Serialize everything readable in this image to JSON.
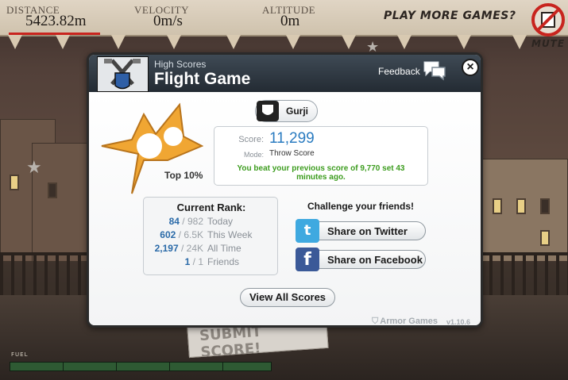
{
  "hud": {
    "distance_label": "DISTANCE",
    "distance_value": "5423.82m",
    "velocity_label": "VELOCITY",
    "velocity_value": "0m/s",
    "altitude_label": "ALTITUDE",
    "altitude_value": "0m",
    "more_games": "PLAY MORE GAMES?",
    "mute_label": "MUTE",
    "fuel_label": "FUEL",
    "fuel_level": 1.0
  },
  "submit_paper_text": "SUBMIT SCORE!",
  "dialog": {
    "subtitle": "High Scores",
    "title": "Flight Game",
    "feedback_label": "Feedback",
    "close_symbol": "×",
    "badge_label": "Top 10%",
    "user_name": "Gurji",
    "score_label": "Score:",
    "score_value": "11,299",
    "mode_label": "Mode:",
    "mode_value": "Throw Score",
    "beat_message": "You beat your previous score of 9,770 set 43 minutes ago.",
    "rank": {
      "title": "Current Rank:",
      "rows": [
        {
          "rank": "84",
          "total": "982",
          "period": "Today"
        },
        {
          "rank": "602",
          "total": "6.5K",
          "period": "This Week"
        },
        {
          "rank": "2,197",
          "total": "24K",
          "period": "All Time"
        },
        {
          "rank": "1",
          "total": "1",
          "period": "Friends"
        }
      ]
    },
    "challenge_title": "Challenge your friends!",
    "twitter_label": "Share on Twitter",
    "facebook_label": "Share on Facebook",
    "view_all_label": "View All Scores",
    "brand": "Armor Games",
    "version": "v1.10.6"
  },
  "colors": {
    "accent_blue": "#2a7bc0",
    "success_green": "#3c9c1e",
    "crown_orange": "#f0a633",
    "twitter": "#3fa9e0",
    "facebook": "#3b5998",
    "mute_red": "#c8241e"
  },
  "icons": [
    "game-thumbnail-icon",
    "speech-bubble-icon",
    "close-icon",
    "crown-icon",
    "shield-avatar-icon",
    "twitter-icon",
    "facebook-icon",
    "armor-shield-icon",
    "mute-icon"
  ]
}
